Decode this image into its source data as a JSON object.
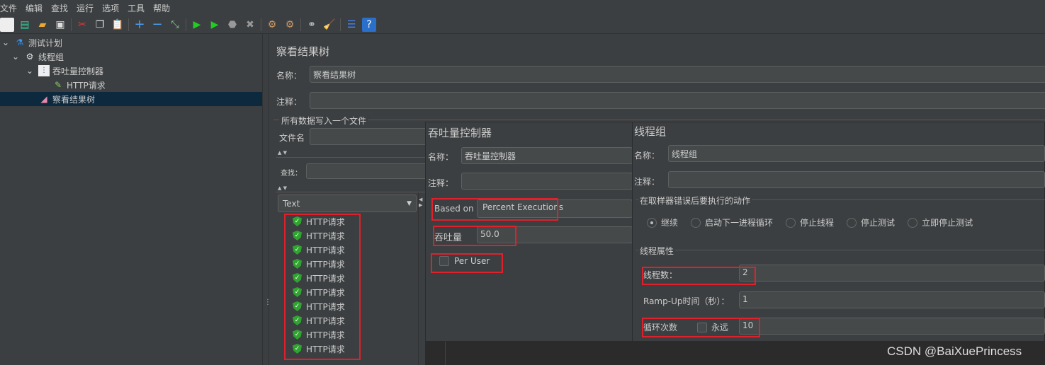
{
  "menu": [
    "文件",
    "编辑",
    "查找",
    "运行",
    "选项",
    "工具",
    "帮助"
  ],
  "toolbar": [
    "new",
    "templates",
    "open",
    "save",
    "cut",
    "copy",
    "paste",
    "expand",
    "collapse",
    "toggle",
    "start",
    "start-no-pause",
    "stop",
    "shutdown",
    "clear",
    "clear-all",
    "search",
    "reset-search",
    "function-helper",
    "help"
  ],
  "tree": [
    {
      "label": "测试计划",
      "icon": "flask-icon"
    },
    {
      "label": "线程组",
      "icon": "gear-icon"
    },
    {
      "label": "吞吐量控制器",
      "icon": "controller-icon"
    },
    {
      "label": "HTTP请求",
      "icon": "pipette-icon"
    },
    {
      "label": "察看结果树",
      "icon": "listener-icon",
      "selected": true
    }
  ],
  "results_tree": {
    "title": "察看结果树",
    "name_label": "名称：",
    "name_value": "察看结果树",
    "comment_label": "注释：",
    "file_group": "所有数据写入一个文件",
    "file_label": "文件名",
    "search_label": "查找：",
    "renderer": "Text",
    "items": [
      "HTTP请求",
      "HTTP请求",
      "HTTP请求",
      "HTTP请求",
      "HTTP请求",
      "HTTP请求",
      "HTTP请求",
      "HTTP请求",
      "HTTP请求",
      "HTTP请求"
    ]
  },
  "throughput": {
    "title": "吞吐量控制器",
    "name_label": "名称：",
    "name_value": "吞吐量控制器",
    "comment_label": "注释：",
    "based_on_label": "Based on",
    "based_on_value": "Percent Executions",
    "throughput_label": "吞吐量",
    "throughput_value": "50.0",
    "per_user_label": "Per User",
    "per_user_checked": false
  },
  "thread_group": {
    "title": "线程组",
    "name_label": "名称：",
    "name_value": "线程组",
    "comment_label": "注释：",
    "error_group": "在取样器错误后要执行的动作",
    "actions": [
      "继续",
      "启动下一进程循环",
      "停止线程",
      "停止测试",
      "立即停止测试"
    ],
    "selected_action": "继续",
    "props_group": "线程属性",
    "threads_label": "线程数：",
    "threads_value": "2",
    "rampup_label": "Ramp-Up时间（秒）：",
    "rampup_value": "1",
    "loop_label": "循环次数",
    "forever_label": "永远",
    "forever_checked": false,
    "loop_value": "10"
  },
  "watermark": "CSDN @BaiXuePrincess",
  "colors": {
    "highlight": "#e0202a",
    "selected": "#0d293e",
    "success": "#2fa52f"
  }
}
